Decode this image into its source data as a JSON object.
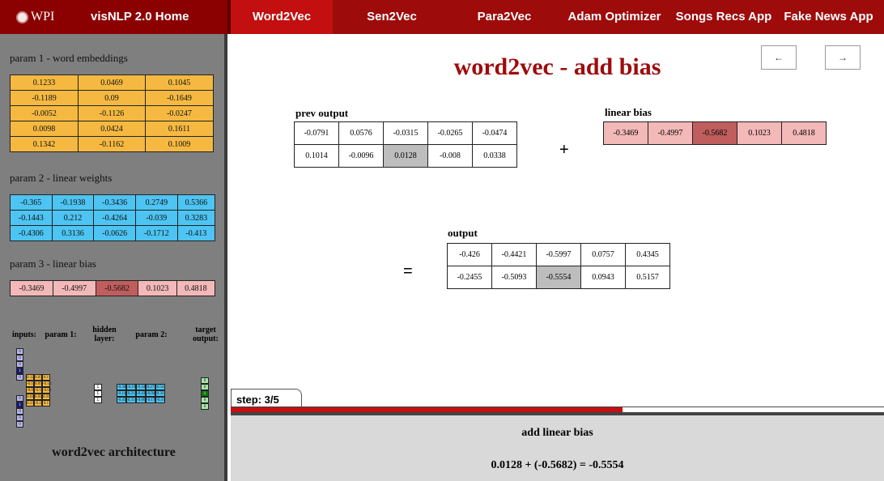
{
  "nav": {
    "logo": "WPI",
    "home": "visNLP 2.0 Home",
    "tabs": [
      "Word2Vec",
      "Sen2Vec",
      "Para2Vec",
      "Adam Optimizer",
      "Songs Recs App",
      "Fake News App"
    ],
    "active_tab": "Word2Vec"
  },
  "left": {
    "param1_title": "param 1 - word embeddings",
    "param1": [
      [
        "0.1233",
        "0.0469",
        "0.1045"
      ],
      [
        "-0.1189",
        "0.09",
        "-0.1649"
      ],
      [
        "-0.0052",
        "-0.1126",
        "-0.0247"
      ],
      [
        "0.0098",
        "0.0424",
        "0.1611"
      ],
      [
        "0.1342",
        "-0.1162",
        "0.1009"
      ]
    ],
    "param2_title": "param 2 - linear weights",
    "param2": [
      [
        "-0.365",
        "-0.1938",
        "-0.3436",
        "0.2749",
        "0.5366"
      ],
      [
        "-0.1443",
        "0.212",
        "-0.4264",
        "-0.039",
        "0.3283"
      ],
      [
        "-0.4306",
        "0.3136",
        "-0.0626",
        "-0.1712",
        "-0.413"
      ]
    ],
    "param3_title": "param 3 - linear bias",
    "param3": [
      "-0.3469",
      "-0.4997",
      "-0.5682",
      "0.1023",
      "0.4818"
    ],
    "arch_labels": {
      "inputs": "inputs:",
      "param1": "param 1:",
      "hidden": "hidden layer:",
      "param2": "param 2:",
      "target": "target output:"
    },
    "arch_inputs_top": [
      "0",
      "0",
      "0",
      "1",
      "0"
    ],
    "arch_inputs_bottom": [
      "0",
      "1",
      "0",
      "0",
      "0"
    ],
    "arch_param1": [
      [
        "0.12",
        "0.05",
        "0.1"
      ],
      [
        "-0.12",
        "0.09",
        "-0.16"
      ],
      [
        "-0.01",
        "-0.11",
        "-0.02"
      ],
      [
        "0.01",
        "0.04",
        "0.16"
      ],
      [
        "0.13",
        "-0.12",
        "0.1"
      ]
    ],
    "arch_hidden": [
      "Σ",
      "Σ",
      "Σ"
    ],
    "arch_param2": [
      [
        "-0.36",
        "-0.19",
        "-0.34",
        "0.27",
        "0.54"
      ],
      [
        "-0.14",
        "0.21",
        "-0.43",
        "-0.04",
        "0.33"
      ],
      [
        "-0.43",
        "0.31",
        "-0.06",
        "-0.17",
        "-0.41"
      ]
    ],
    "arch_target": [
      "0",
      "0",
      "1",
      "0",
      "0"
    ],
    "arch_caption": "word2vec architecture"
  },
  "main": {
    "title": "word2vec - add bias",
    "prev_label": "←",
    "next_label": "→",
    "prev_output_label": "prev output",
    "prev_output": [
      [
        "-0.0791",
        "0.0576",
        "-0.0315",
        "-0.0265",
        "-0.0474"
      ],
      [
        "0.1014",
        "-0.0096",
        "0.0128",
        "-0.008",
        "0.0338"
      ]
    ],
    "plus": "+",
    "linear_bias_label": "linear bias",
    "linear_bias": [
      "-0.3469",
      "-0.4997",
      "-0.5682",
      "0.1023",
      "0.4818"
    ],
    "equals": "=",
    "output_label": "output",
    "output": [
      [
        "-0.426",
        "-0.4421",
        "-0.5997",
        "0.0757",
        "0.4345"
      ],
      [
        "-0.2455",
        "-0.5093",
        "-0.5554",
        "0.0943",
        "0.5157"
      ]
    ],
    "step": "step: 3/5",
    "progress": 0.6,
    "bottom_title": "add linear bias",
    "bottom_formula": "0.0128 + (-0.5682) = -0.5554"
  }
}
